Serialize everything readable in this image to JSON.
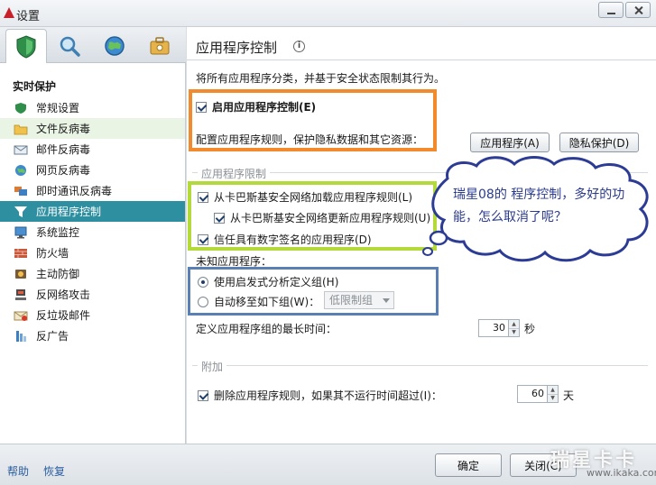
{
  "window": {
    "title": "设置"
  },
  "nav": {
    "header": "实时保护",
    "items": [
      {
        "label": "常规设置",
        "icon": "shield-icon"
      },
      {
        "label": "文件反病毒",
        "icon": "folder-icon"
      },
      {
        "label": "邮件反病毒",
        "icon": "mail-icon"
      },
      {
        "label": "网页反病毒",
        "icon": "globe-icon"
      },
      {
        "label": "即时通讯反病毒",
        "icon": "chat-icon"
      },
      {
        "label": "应用程序控制",
        "icon": "filter-icon",
        "selected": true
      },
      {
        "label": "系统监控",
        "icon": "monitor-icon"
      },
      {
        "label": "防火墙",
        "icon": "firewall-icon"
      },
      {
        "label": "主动防御",
        "icon": "defense-icon"
      },
      {
        "label": "反网络攻击",
        "icon": "network-icon"
      },
      {
        "label": "反垃圾邮件",
        "icon": "spam-icon"
      },
      {
        "label": "反广告",
        "icon": "ad-icon"
      }
    ]
  },
  "main": {
    "title": "应用程序控制",
    "description": "将所有应用程序分类，并基于安全状态限制其行为。",
    "enable_label": "启用应用程序控制(E)",
    "configure_text": "配置应用程序规则，保护隐私数据和其它资源：",
    "apps_button": "应用程序(A)",
    "privacy_button": "隐私保护(D)",
    "restrictions_section": "应用程序限制",
    "load_rules_label": "从卡巴斯基安全网络加载应用程序规则(L)",
    "update_rules_label": "从卡巴斯基安全网络更新应用程序规则(U)",
    "trust_signed_label": "信任具有数字签名的应用程序(D)",
    "unknown_label": "未知应用程序：",
    "heuristic_label": "使用启发式分析定义组(H)",
    "auto_move_label": "自动移至如下组(W)：",
    "group_select": "低限制组",
    "max_time_label": "定义应用程序组的最长时间：",
    "max_time_value": "30",
    "max_time_unit": "秒",
    "additional_section": "附加",
    "delete_rules_label": "删除应用程序规则，如果其不运行时间超过(I)：",
    "delete_days_value": "60",
    "delete_days_unit": "天"
  },
  "bottom": {
    "help": "帮助",
    "restore": "恢复",
    "ok": "确定",
    "close": "关闭(C)"
  },
  "annotation": {
    "text": "瑞星08的 程序控制，多好的功能，怎么取消了呢？"
  },
  "watermark": {
    "line1": "瑞星卡卡",
    "line2": "www.ikaka.com"
  },
  "colors": {
    "accent": "#2e8fa1",
    "orange_box": "#f28a2e",
    "green_box": "#b3d93a",
    "blue_box": "#5a7fb2",
    "bubble": "#2c3c94"
  }
}
